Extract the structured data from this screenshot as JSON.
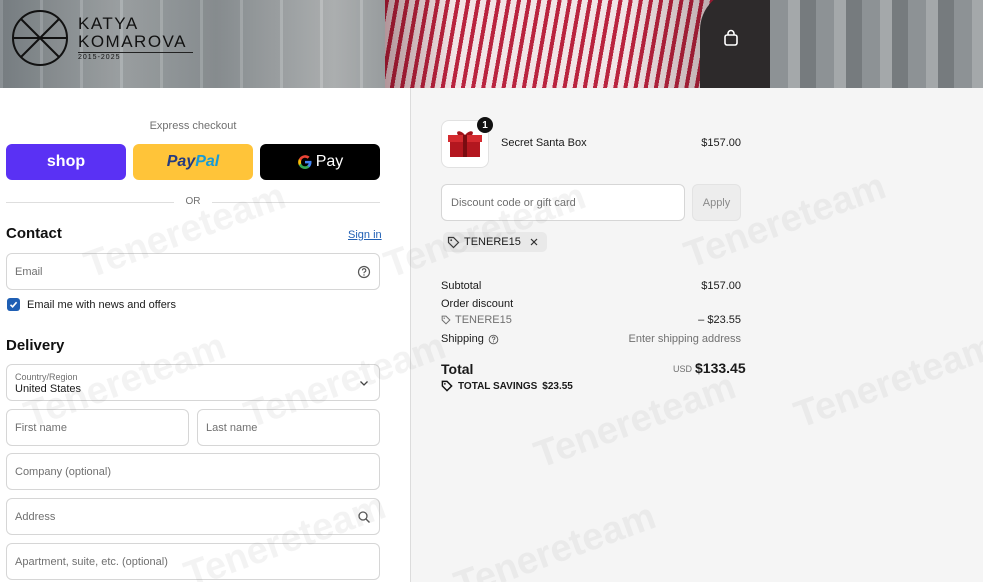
{
  "brand": {
    "name_line1": "KATYA",
    "name_line2": "KOMAROVA",
    "years": "2015-2025"
  },
  "express": {
    "title": "Express checkout",
    "shop_label": "shop",
    "paypal_label_a": "Pay",
    "paypal_label_b": "Pal",
    "gpay_label": "Pay",
    "or_label": "OR"
  },
  "contact": {
    "heading": "Contact",
    "sign_in": "Sign in",
    "email_placeholder": "Email",
    "newsletter_label": "Email me with news and offers",
    "newsletter_checked": true
  },
  "delivery": {
    "heading": "Delivery",
    "country_label": "Country/Region",
    "country_value": "United States",
    "first_name_placeholder": "First name",
    "last_name_placeholder": "Last name",
    "company_placeholder": "Company (optional)",
    "address_placeholder": "Address",
    "apartment_placeholder": "Apartment, suite, etc. (optional)"
  },
  "summary": {
    "item": {
      "name": "Secret Santa Box",
      "price": "$157.00",
      "quantity": "1"
    },
    "discount_placeholder": "Discount code or gift card",
    "apply_label": "Apply",
    "applied_code": "TENERE15",
    "subtotal_label": "Subtotal",
    "subtotal_value": "$157.00",
    "order_discount_label": "Order discount",
    "discount_code": "TENERE15",
    "discount_value": "– $23.55",
    "shipping_label": "Shipping",
    "shipping_value": "Enter shipping address",
    "total_label": "Total",
    "total_currency": "USD",
    "total_value": "$133.45",
    "savings_label": "TOTAL SAVINGS",
    "savings_value": "$23.55"
  },
  "watermark": "Tenereteam",
  "colors": {
    "shop": "#5a31f4",
    "paypal": "#ffc439",
    "gpay": "#000000",
    "link": "#1f5fb4"
  }
}
